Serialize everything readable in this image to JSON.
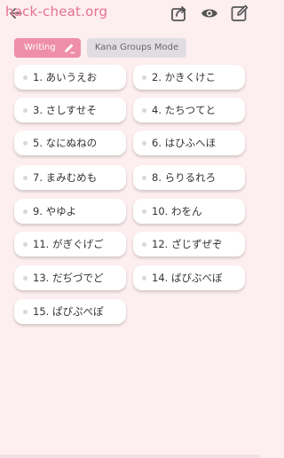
{
  "header": {
    "watermark": "hack-cheat.org",
    "back_icon": "back-arrow-icon",
    "actions": [
      "share-icon",
      "eye-icon",
      "edit-icon"
    ]
  },
  "modes": {
    "writing_label": "Writing",
    "kana_groups_label": "Kana Groups Mode"
  },
  "groups": [
    {
      "label": "1. あいうえお"
    },
    {
      "label": "2. かきくけこ"
    },
    {
      "label": "3. さしすせそ"
    },
    {
      "label": "4. たちつてと"
    },
    {
      "label": "5. なにぬねの"
    },
    {
      "label": "6. はひふへほ"
    },
    {
      "label": "7. まみむめも"
    },
    {
      "label": "8. らりるれろ"
    },
    {
      "label": "9. やゆよ"
    },
    {
      "label": "10. わをん"
    },
    {
      "label": "11. がぎぐげご"
    },
    {
      "label": "12. ざじずぜぞ"
    },
    {
      "label": "13. だぢづでど"
    },
    {
      "label": "14. ばびぶべぼ"
    },
    {
      "label": "15. ぱぴぷぺぽ"
    }
  ],
  "colors": {
    "background": "#fdeef0",
    "accent": "#ef8ea8",
    "inactive_tab": "#e0dde2"
  }
}
